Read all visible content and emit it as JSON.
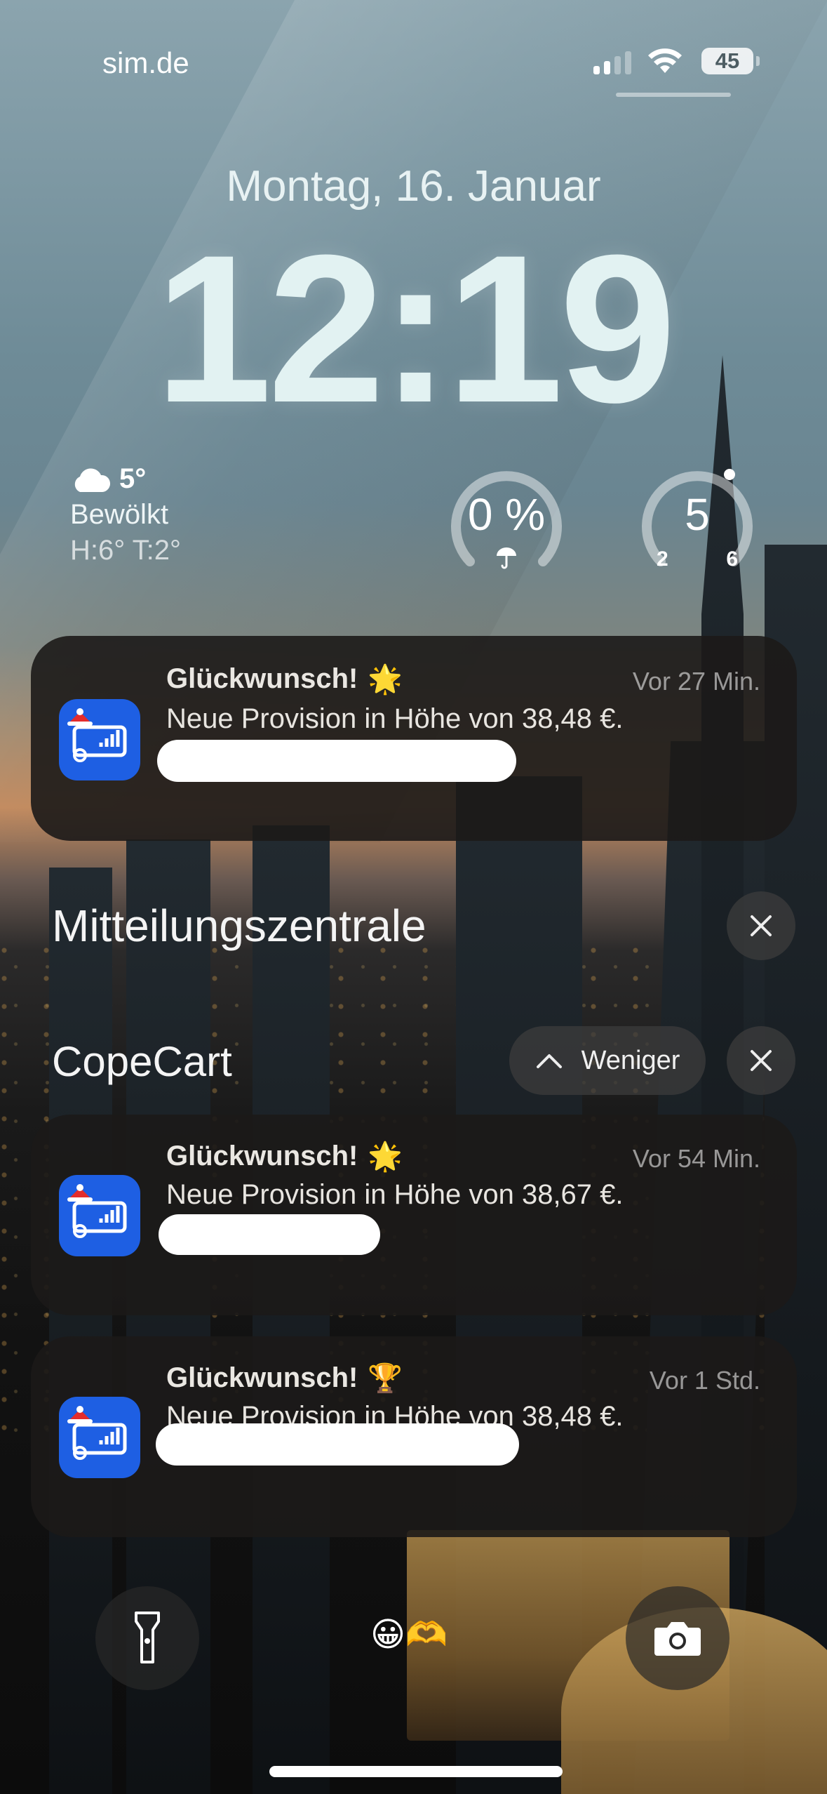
{
  "status_bar": {
    "carrier": "sim.de",
    "battery": "45",
    "signal_icon": "cellular-signal-icon",
    "wifi_icon": "wifi-icon"
  },
  "lock_screen": {
    "date": "Montag, 16. Januar",
    "time": "12:19"
  },
  "widgets": {
    "weather": {
      "temp": "5°",
      "condition": "Bewölkt",
      "high_low": "H:6° T:2°",
      "icon": "cloud-icon"
    },
    "precipitation": {
      "value": "0 %",
      "icon": "umbrella-icon"
    },
    "temperature_gauge": {
      "value": "5",
      "min": "2",
      "max": "6"
    }
  },
  "top_notification": {
    "title": "Glückwunsch!",
    "emoji": "🌟",
    "time": "Vor 27 Min.",
    "body": "Neue Provision in Höhe von 38,48 €."
  },
  "notification_center": {
    "title": "Mitteilungszentrale",
    "group_name": "CopeCart",
    "less_label": "Weniger",
    "notifications": [
      {
        "title": "Glückwunsch!",
        "emoji": "🌟",
        "time": "Vor 54 Min.",
        "body": "Neue Provision in Höhe von 38,67 €."
      },
      {
        "title": "Glückwunsch!",
        "emoji": "🏆",
        "time": "Vor 1 Std.",
        "body": "Neue Provision in Höhe von 38,48 €."
      }
    ]
  },
  "bottom": {
    "flashlight_icon": "flashlight-icon",
    "camera_icon": "camera-icon",
    "emojis": "😀🫶"
  },
  "colors": {
    "app_icon": "#1e5fe3",
    "notification_bg": "#1c1a18"
  }
}
